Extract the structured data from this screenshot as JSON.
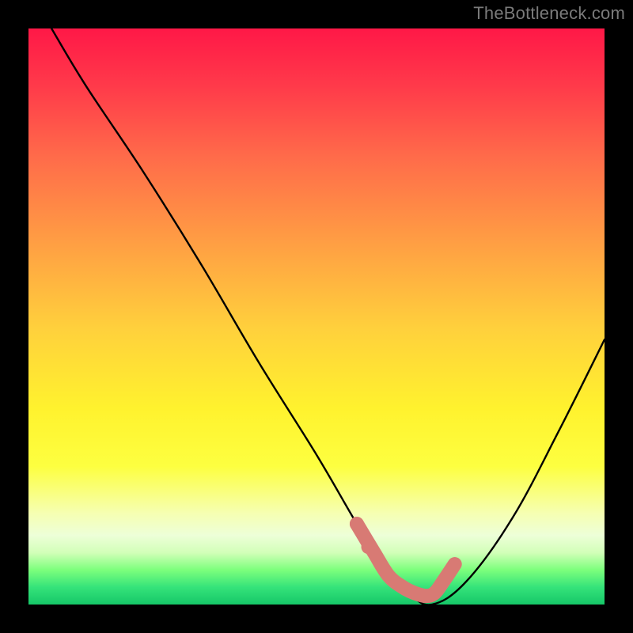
{
  "watermark": "TheBottleneck.com",
  "chart_data": {
    "type": "line",
    "title": "",
    "xlabel": "",
    "ylabel": "",
    "xlim": [
      0,
      100
    ],
    "ylim": [
      0,
      100
    ],
    "series": [
      {
        "name": "bottleneck-curve",
        "x": [
          4,
          10,
          20,
          30,
          40,
          50,
          57,
          62,
          66,
          70,
          76,
          84,
          92,
          100
        ],
        "y": [
          100,
          90,
          75,
          59,
          42,
          26,
          14,
          6,
          2,
          0,
          4,
          15,
          30,
          46
        ],
        "color": "#000000"
      },
      {
        "name": "highlight-band",
        "x": [
          57,
          60,
          62.5,
          65,
          67,
          69,
          70.5,
          72,
          74
        ],
        "y": [
          14,
          9,
          5,
          3,
          2,
          1.5,
          2,
          4,
          7
        ],
        "color": "#d87a74"
      }
    ],
    "highlight_markers": {
      "color": "#d87a74",
      "points": [
        {
          "x": 57,
          "y": 14
        },
        {
          "x": 59,
          "y": 10
        }
      ]
    }
  }
}
